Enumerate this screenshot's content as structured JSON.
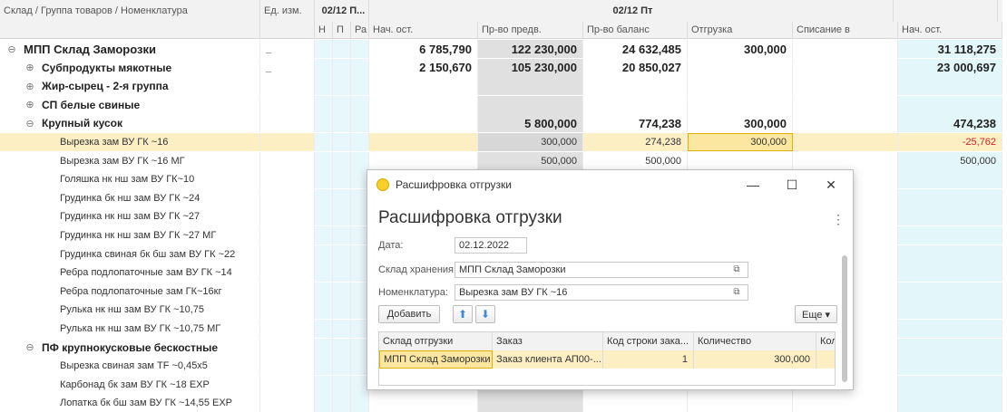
{
  "header": {
    "col_name": "Склад / Группа товаров / Номенклатура",
    "col_unit": "Ед. изм.",
    "date_short": "02/12 П...",
    "date_full": "02/12 Пт",
    "sub_n": "Н",
    "sub_p": "П",
    "sub_r": "Ра",
    "start": "Нач. ост.",
    "prev": "Пр-во предв.",
    "balance": "Пр-во баланс",
    "ship": "Отгрузка",
    "writeoff": "Списание в",
    "end": "Нач. ост."
  },
  "rows": [
    {
      "name": "МПП Склад Заморозки",
      "unit": "_",
      "start": "6 785,790",
      "prev": "122 230,000",
      "balance": "24 632,485",
      "ship": "300,000",
      "writeoff": "",
      "end": "31 118,275",
      "toggle": "⊖"
    },
    {
      "name": "Субпродукты мякотные",
      "unit": "_",
      "start": "2 150,670",
      "prev": "105 230,000",
      "balance": "20 850,027",
      "ship": "",
      "writeoff": "",
      "end": "23 000,697",
      "toggle": "⊕"
    },
    {
      "name": "Жир-сырец - 2-я группа",
      "unit": "",
      "start": "",
      "prev": "",
      "balance": "",
      "ship": "",
      "writeoff": "",
      "end": "",
      "toggle": "⊕"
    },
    {
      "name": "СП белые свиные",
      "unit": "",
      "start": "",
      "prev": "",
      "balance": "",
      "ship": "",
      "writeoff": "",
      "end": "",
      "toggle": "⊕"
    },
    {
      "name": "Крупный кусок",
      "unit": "",
      "start": "",
      "prev": "5 800,000",
      "balance": "774,238",
      "ship": "300,000",
      "writeoff": "",
      "end": "474,238",
      "toggle": "⊖"
    },
    {
      "name": "Вырезка зам ВУ ГК ~16",
      "unit": "",
      "start": "",
      "prev": "300,000",
      "balance": "274,238",
      "ship": "300,000",
      "writeoff": "",
      "end": "-25,762"
    },
    {
      "name": "Вырезка зам ВУ ГК ~16 МГ",
      "unit": "",
      "start": "",
      "prev": "500,000",
      "balance": "500,000",
      "ship": "",
      "writeoff": "",
      "end": "500,000"
    },
    {
      "name": "Голяшка нк нш зам ВУ ГК~10"
    },
    {
      "name": "Грудинка бк нш зам ВУ ГК ~24"
    },
    {
      "name": "Грудинка нк нш зам ВУ ГК ~27"
    },
    {
      "name": "Грудинка нк нш зам ВУ ГК ~27 МГ"
    },
    {
      "name": "Грудинка свиная бк бш зам ВУ ГК ~22"
    },
    {
      "name": "Ребра подлопаточные зам ВУ ГК ~14"
    },
    {
      "name": "Ребра подлопаточные зам ГК~16кг"
    },
    {
      "name": "Рулька нк нш зам ВУ ГК ~10,75"
    },
    {
      "name": "Рулька нк нш зам ВУ ГК ~10,75 МГ"
    },
    {
      "name": "ПФ крупнокусковые бескостные",
      "toggle": "⊖"
    },
    {
      "name": "Вырезка свиная зам TF ~0,45x5"
    },
    {
      "name": "Карбонад бк зам ВУ ГК ~18 EXP"
    },
    {
      "name": "Лопатка бк бш зам ВУ ГК ~14,55 EXP"
    }
  ],
  "dialog": {
    "window_title": "Расшифровка отгрузки",
    "title": "Расшифровка отгрузки",
    "minimize": "—",
    "maximize": "☐",
    "close": "✕",
    "more": "⋮",
    "date_label": "Дата:",
    "date_value": "02.12.2022",
    "warehouse_label": "Склад хранения:",
    "warehouse_value": "МПП Склад Заморозки",
    "item_label": "Номенклатура:",
    "item_value": "Вырезка зам ВУ ГК ~16",
    "add_button": "Добавить",
    "more_button": "Еще ▾",
    "table": {
      "headers": [
        "Склад отгрузки",
        "Заказ",
        "Код строки зака...",
        "Количество",
        "Кол"
      ],
      "row": [
        "МПП Склад Заморозки",
        "Заказ клиента АП00-...",
        "1",
        "300,000",
        ""
      ]
    }
  }
}
